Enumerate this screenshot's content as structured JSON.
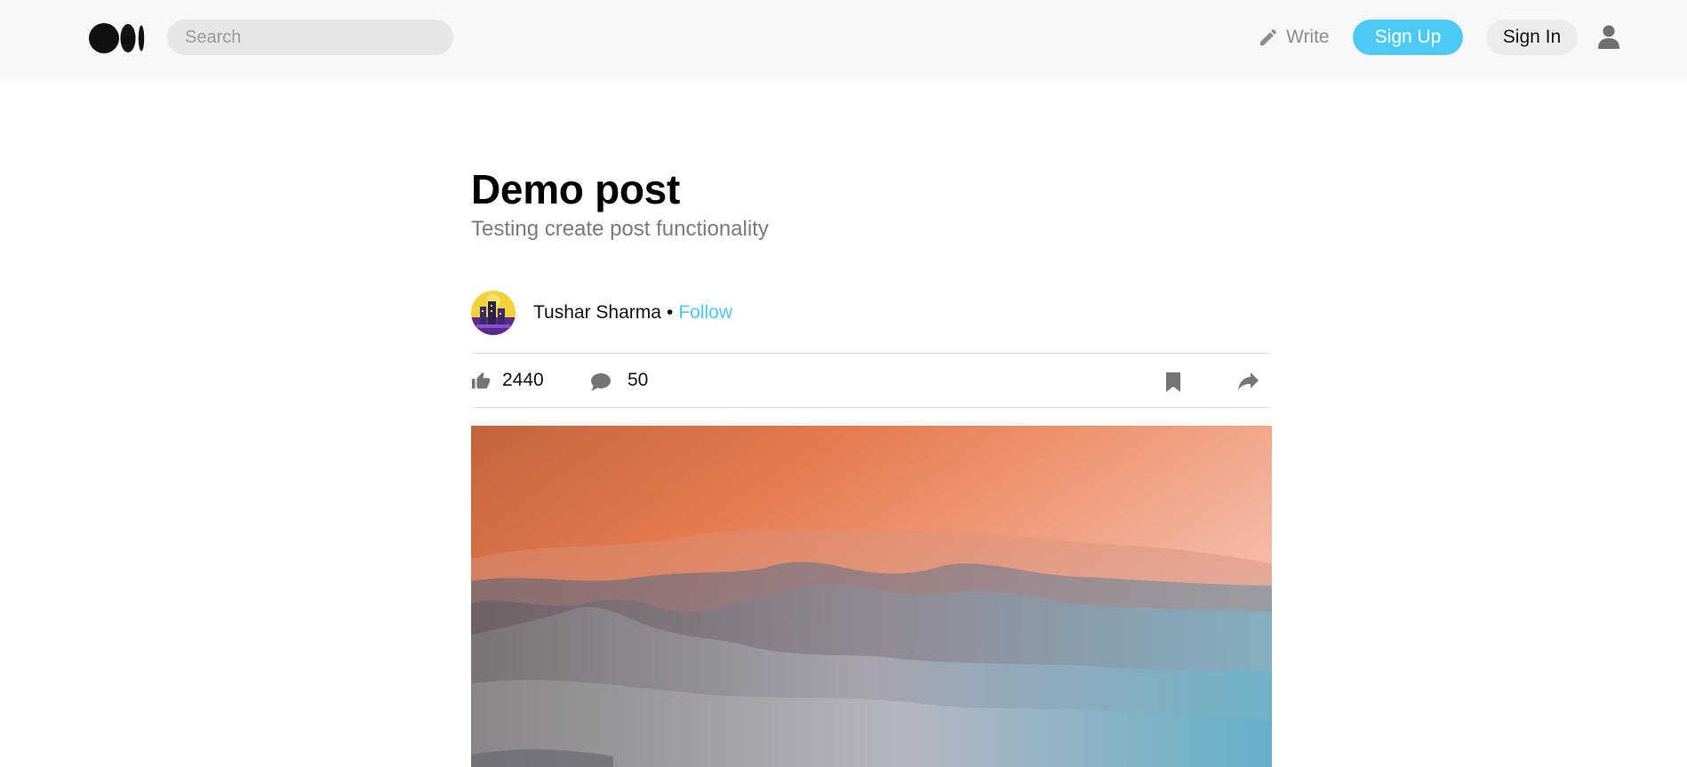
{
  "header": {
    "search_placeholder": "Search",
    "write_label": "Write",
    "signup_label": "Sign Up",
    "signin_label": "Sign In"
  },
  "post": {
    "title": "Demo post",
    "subtitle": "Testing create post functionality",
    "author_name": "Tushar Sharma",
    "separator": "•",
    "follow_label": "Follow",
    "likes": "2440",
    "comments": "50"
  },
  "colors": {
    "accent": "#4ccaf5",
    "header_bg": "#f8f8f8",
    "muted_text": "#7a7a7a"
  },
  "icons": [
    "medium-logo",
    "pencil-icon",
    "user-icon",
    "thumbs-up-icon",
    "comment-icon",
    "bookmark-icon",
    "share-icon"
  ]
}
